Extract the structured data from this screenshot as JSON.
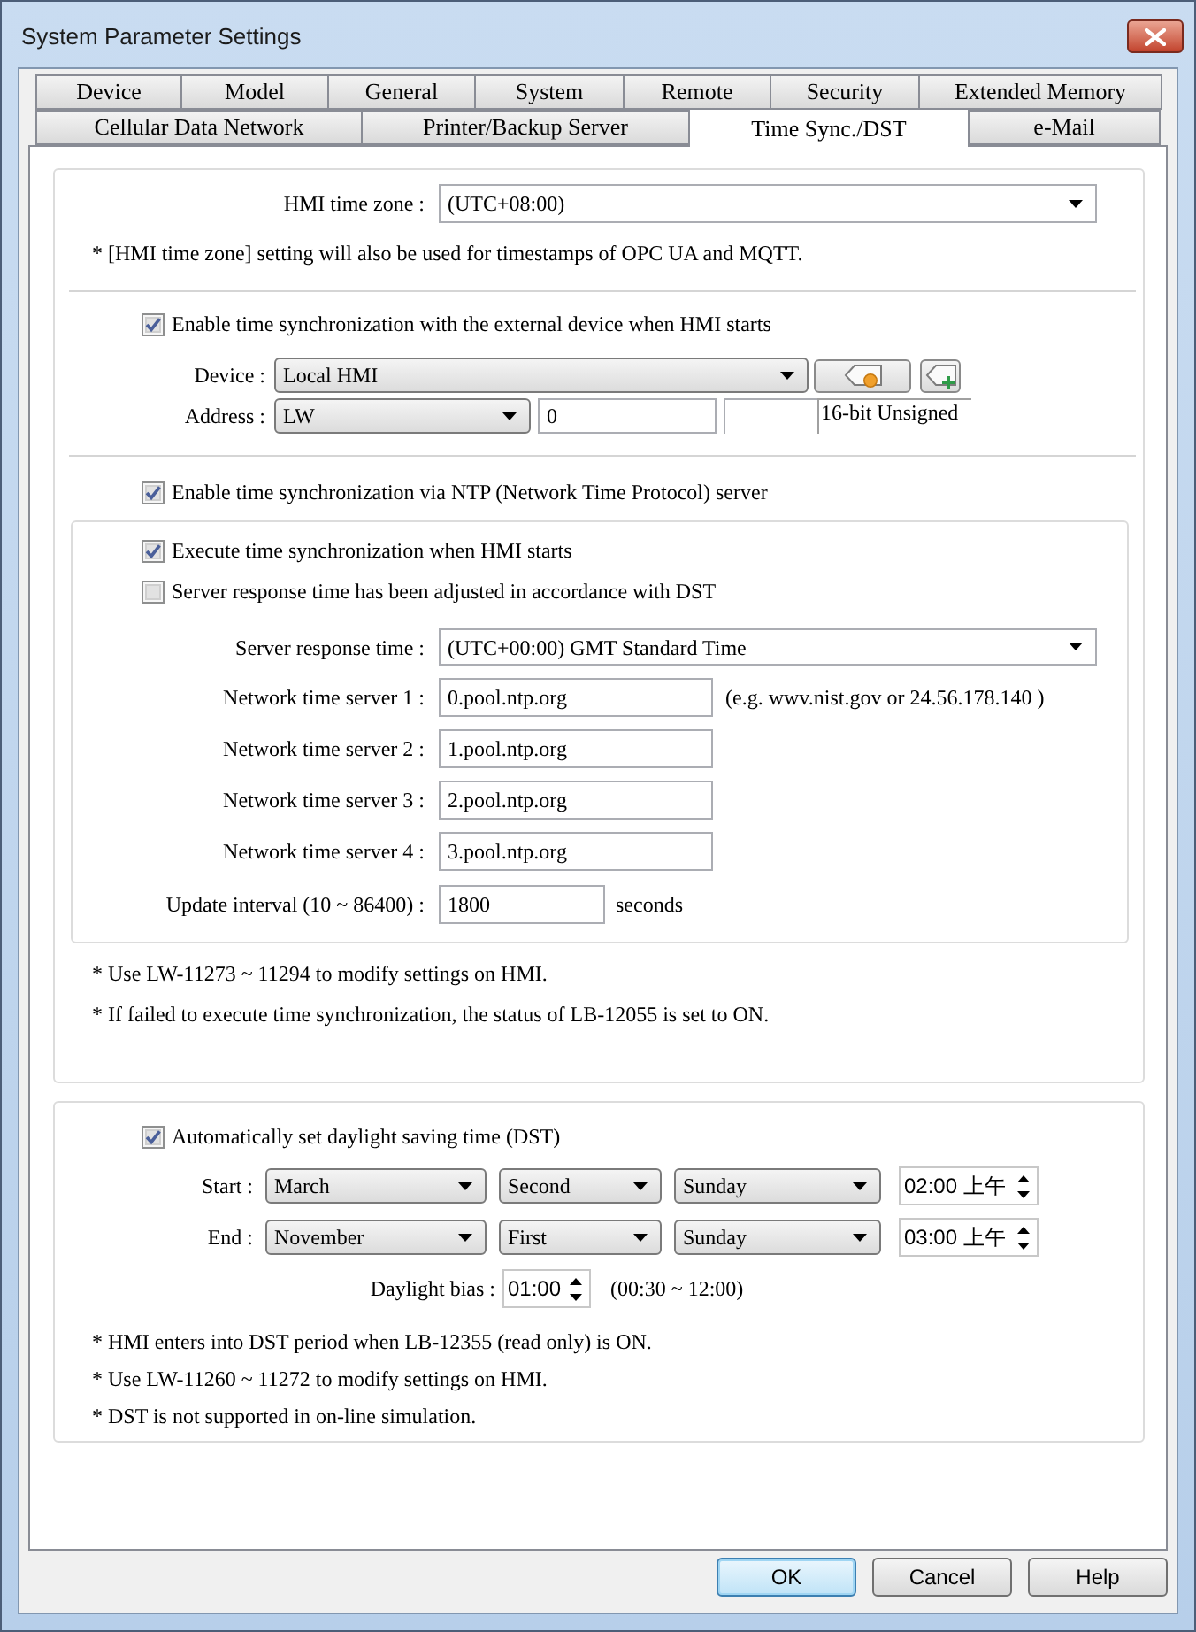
{
  "window": {
    "title": "System Parameter Settings"
  },
  "tab_rows": [
    {
      "tabs": [
        {
          "label": "Device",
          "selected": false
        },
        {
          "label": "Model",
          "selected": false
        },
        {
          "label": "General",
          "selected": false
        },
        {
          "label": "System",
          "selected": false
        },
        {
          "label": "Remote",
          "selected": false
        },
        {
          "label": "Security",
          "selected": false
        },
        {
          "label": "Extended Memory",
          "selected": false
        }
      ]
    },
    {
      "tabs": [
        {
          "label": "Cellular Data Network",
          "selected": false
        },
        {
          "label": "Printer/Backup Server",
          "selected": false
        },
        {
          "label": "Time Sync./DST",
          "selected": true
        },
        {
          "label": "e-Mail",
          "selected": false
        }
      ]
    }
  ],
  "time_zone": {
    "label": "HMI time zone :",
    "value": "(UTC+08:00)",
    "note": "* [HMI time zone] setting will also be used for timestamps of OPC UA and MQTT."
  },
  "external_sync": {
    "enable": {
      "label": "Enable time synchronization with the external device when HMI starts",
      "checked": true
    },
    "device": {
      "label": "Device :",
      "value": "Local HMI"
    },
    "address": {
      "label": "Address :",
      "type": "LW",
      "value": "0",
      "data_type": "16-bit Unsigned"
    }
  },
  "ntp": {
    "enable": {
      "label": "Enable time synchronization via NTP (Network Time Protocol) server",
      "checked": true
    },
    "options": [
      {
        "label": "Execute time synchronization when HMI starts",
        "checked": true
      },
      {
        "label": "Server response time has been adjusted in accordance with DST",
        "checked": false
      }
    ],
    "server_response_time": {
      "label": "Server response time :",
      "value": "(UTC+00:00) GMT Standard Time"
    },
    "servers": [
      {
        "label": "Network time server 1 :",
        "value": "0.pool.ntp.org",
        "hint": "(e.g. wwv.nist.gov or 24.56.178.140 )"
      },
      {
        "label": "Network time server 2 :",
        "value": "1.pool.ntp.org"
      },
      {
        "label": "Network time server 3 :",
        "value": "2.pool.ntp.org"
      },
      {
        "label": "Network time server 4 :",
        "value": "3.pool.ntp.org"
      }
    ],
    "update_interval": {
      "label": "Update interval (10 ~ 86400) :",
      "value": "1800",
      "unit": "seconds"
    },
    "notes": [
      "* Use LW-11273 ~ 11294 to modify settings on HMI.",
      "* If failed to execute time synchronization, the status of LB-12055 is set to ON."
    ]
  },
  "dst": {
    "enable": {
      "label": "Automatically set daylight saving time (DST)",
      "checked": true
    },
    "rules": [
      {
        "label": "Start :",
        "month": "March",
        "week": "Second",
        "day": "Sunday",
        "time": "02:00 上午"
      },
      {
        "label": "End :",
        "month": "November",
        "week": "First",
        "day": "Sunday",
        "time": "03:00 上午"
      }
    ],
    "bias": {
      "label": "Daylight bias :",
      "value": "01:00",
      "range": "(00:30 ~ 12:00)"
    },
    "notes": [
      "* HMI enters into DST period when LB-12355 (read only) is ON.",
      "* Use LW-11260 ~ 11272 to modify settings on HMI.",
      "* DST is not supported in on-line simulation."
    ]
  },
  "buttons": [
    {
      "label": "OK",
      "default": true
    },
    {
      "label": "Cancel",
      "default": false
    },
    {
      "label": "Help",
      "default": false
    }
  ]
}
